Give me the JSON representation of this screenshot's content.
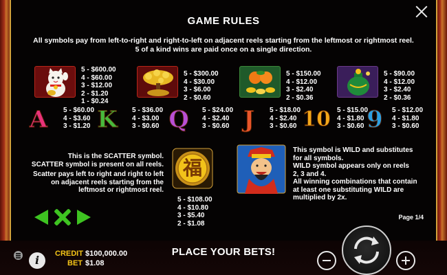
{
  "panel": {
    "title": "GAME RULES",
    "intro_line1": "All symbols pay from left-to-right and right-to-left on adjacent reels starting from the leftmost or rightmost reel.",
    "intro_line2": "5 of a kind wins are paid once on a single direction.",
    "page_indicator": "Page 1/4"
  },
  "high_symbols": [
    {
      "icon": "lucky-cat-icon",
      "pays": [
        "5 - $600.00",
        "4 - $60.00",
        "3 - $12.00",
        "2 - $1.20",
        "1 - $0.24"
      ]
    },
    {
      "icon": "gold-tree-icon",
      "pays": [
        "5 - $300.00",
        "4 - $30.00",
        "3 - $6.00",
        "2 - $0.60"
      ]
    },
    {
      "icon": "oranges-icon",
      "pays": [
        "5 - $150.00",
        "4 - $12.00",
        "3 - $2.40",
        "2 - $0.36"
      ]
    },
    {
      "icon": "green-bag-icon",
      "pays": [
        "5 - $90.00",
        "4 - $12.00",
        "3 - $2.40",
        "2 - $0.36"
      ]
    }
  ],
  "low_symbols": [
    {
      "glyph": "A",
      "color": "#e8327a",
      "pays": [
        "5 - $60.00",
        "4 - $3.60",
        "3 - $1.20"
      ]
    },
    {
      "glyph": "K",
      "color": "#47b83c",
      "pays": [
        "5 - $36.00",
        "4 - $3.00",
        "3 - $0.60"
      ]
    },
    {
      "glyph": "Q",
      "color": "#b84fd6",
      "pays": [
        "5 - $24.00",
        "4 - $2.40",
        "3 - $0.60"
      ]
    },
    {
      "glyph": "J",
      "color": "#e8552a",
      "pays": [
        "5 - $18.00",
        "4 - $2.40",
        "3 - $0.60"
      ]
    },
    {
      "glyph": "10",
      "color": "#f2a81a",
      "pays": [
        "5 - $15.00",
        "4 - $1.80",
        "3 - $0.60"
      ]
    },
    {
      "glyph": "9",
      "color": "#2c9fe0",
      "pays": [
        "5 - $12.00",
        "4 - $1.80",
        "3 - $0.60"
      ]
    }
  ],
  "scatter": {
    "icon": "fu-coin-scatter-icon",
    "glyph": "福",
    "line1": "This is the SCATTER symbol.",
    "line2": "SCATTER symbol is present on all reels.",
    "line3": "Scatter pays left to right and right to left",
    "line4": "on adjacent reels starting from the",
    "line5": "leftmost or rightmost reel.",
    "pays": [
      "5 - $108.00",
      "4 - $10.80",
      "3 - $5.40",
      "2 - $1.08"
    ]
  },
  "wild": {
    "icon": "fortune-god-wild-icon",
    "line1": "This symbol is WILD and substitutes",
    "line2": "for all symbols.",
    "line3": "WILD symbol appears only on reels",
    "line4": "2, 3 and 4.",
    "line5": "All winning combinations that contain",
    "line6": "at least one substituting WILD are",
    "line7": "multiplied by 2x."
  },
  "bottom_bar": {
    "credit_label": "CREDIT",
    "credit_value": "$100,000.00",
    "bet_label": "BET",
    "bet_value": "$1.08",
    "message": "PLACE YOUR BETS!"
  },
  "colors": {
    "accent_gold": "#f5c518",
    "nav_green": "#3ec321",
    "frame_gold": "#d4a23a"
  }
}
